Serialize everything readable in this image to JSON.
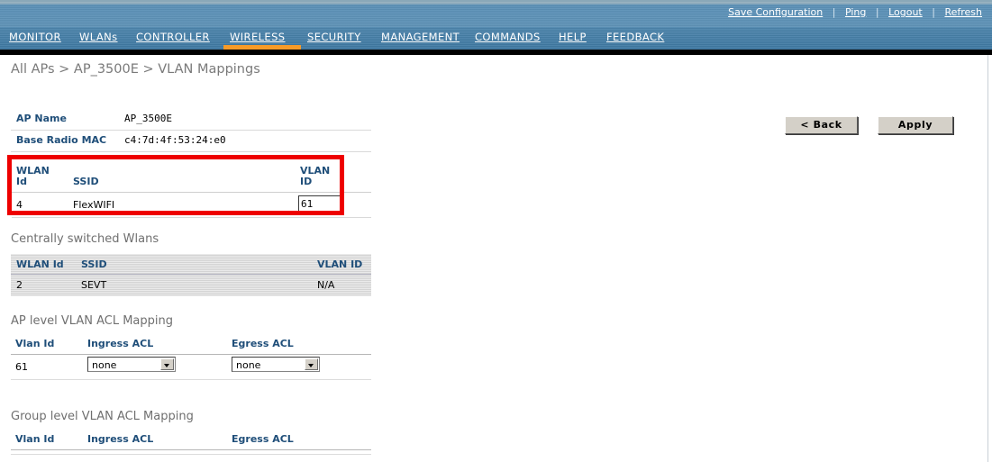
{
  "header": {
    "links": [
      {
        "label": "Save Configuration",
        "name": "save-configuration-link"
      },
      {
        "label": "Ping",
        "name": "ping-link"
      },
      {
        "label": "Logout",
        "name": "logout-link"
      },
      {
        "label": "Refresh",
        "name": "refresh-link"
      }
    ],
    "separator": "|"
  },
  "nav": {
    "active": "WIRELESS",
    "items": [
      {
        "label": "MONITOR"
      },
      {
        "label": "WLANs"
      },
      {
        "label": "CONTROLLER"
      },
      {
        "label": "WIRELESS"
      },
      {
        "label": "SECURITY"
      },
      {
        "label": "MANAGEMENT"
      },
      {
        "label": "COMMANDS"
      },
      {
        "label": "HELP"
      },
      {
        "label": "FEEDBACK"
      }
    ]
  },
  "page": {
    "breadcrumb": "All APs > AP_3500E > VLAN Mappings",
    "buttons": {
      "back": "< Back",
      "apply": "Apply"
    }
  },
  "ap_info": {
    "rows": [
      {
        "label": "AP Name",
        "value": "AP_3500E"
      },
      {
        "label": "Base Radio MAC",
        "value": "c4:7d:4f:53:24:e0"
      }
    ]
  },
  "locally_switched": {
    "headers": {
      "wlan_id_line1": "WLAN",
      "wlan_id_line2": "Id",
      "ssid": "SSID",
      "vlan_id_line1": "VLAN",
      "vlan_id_line2": "ID"
    },
    "rows": [
      {
        "wlan_id": "4",
        "ssid": "FlexWIFI",
        "vlan_id": "61"
      }
    ]
  },
  "centrally_switched": {
    "title": "Centrally switched Wlans",
    "headers": {
      "wlan_id": "WLAN Id",
      "ssid": "SSID",
      "vlan_id": "VLAN ID"
    },
    "rows": [
      {
        "wlan_id": "2",
        "ssid": "SEVT",
        "vlan_id": "N/A"
      }
    ]
  },
  "ap_level_acl": {
    "title": "AP level VLAN ACL Mapping",
    "headers": {
      "vlan_id": "Vlan Id",
      "ingress": "Ingress ACL",
      "egress": "Egress ACL"
    },
    "rows": [
      {
        "vlan_id": "61",
        "ingress": "none",
        "egress": "none"
      }
    ]
  },
  "group_level_acl": {
    "title": "Group level VLAN ACL Mapping",
    "headers": {
      "vlan_id": "Vlan Id",
      "ingress": "Ingress ACL",
      "egress": "Egress ACL"
    },
    "rows": []
  },
  "colors": {
    "banner_blue": "#5d92b8",
    "nav_blue": "#4681a8",
    "active_tab_orange": "#f79b28",
    "highlight_red": "#ee0000",
    "header_text_navy": "#1f4e79",
    "table_gray": "#d8d8d8"
  }
}
